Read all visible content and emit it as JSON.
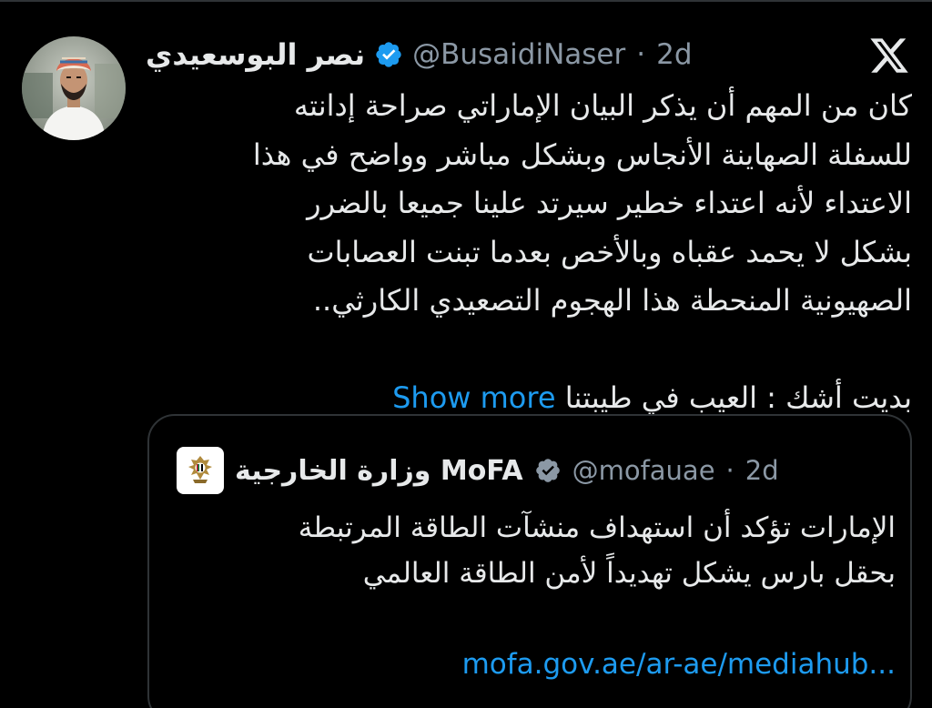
{
  "tweet": {
    "display_name": "نصر البوسعيدي",
    "handle": "@BusaidiNaser",
    "separator": "·",
    "age": "2d",
    "lines": [
      "كان من المهم أن يذكر البيان الإماراتي صراحة إدانته",
      "للسفلة الصهاينة الأنجاس وبشكل مباشر وواضح في هذا",
      "الاعتداء لأنه اعتداء خطير سيرتد علينا جميعا بالضرر",
      "بشكل لا يحمد عقباه وبالأخص بعدما تبنت العصابات",
      "الصهيونية المنحطة هذا الهجوم التصعيدي الكارثي.."
    ],
    "last_line": "بديت أشك : العيب في طيبتنا",
    "show_more": "Show more"
  },
  "quote": {
    "display_name": "وزارة الخارجية MoFA",
    "handle": "@mofauae",
    "separator": "·",
    "age": "2d",
    "lines": [
      "الإمارات تؤكد أن استهداف منشآت الطاقة المرتبطة",
      "بحقل بارس يشكل تهديداً لأمن الطاقة العالمي"
    ],
    "link": "mofa.gov.ae/ar-ae/mediahub..."
  },
  "icons": {
    "x_logo": "x-logo-icon",
    "verified": "verified-badge-icon",
    "emblem": "uae-emblem-icon"
  },
  "colors": {
    "background": "#000000",
    "text": "#e7e9ea",
    "muted": "#8b98a5",
    "link": "#1d9bf0",
    "verified": "#1d9bf0",
    "border": "#2f3336"
  }
}
